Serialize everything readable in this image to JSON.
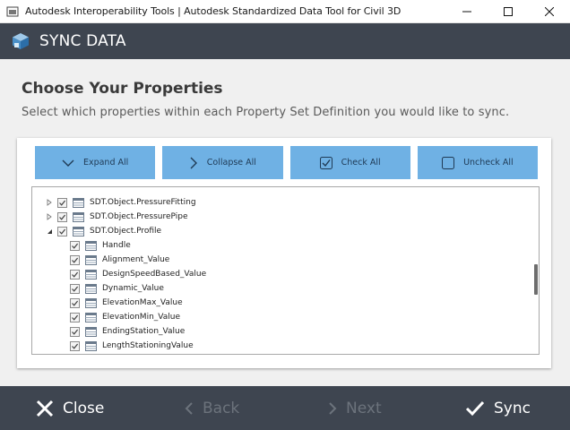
{
  "window": {
    "title": "Autodesk Interoperability Tools | Autodesk Standardized Data Tool for Civil 3D",
    "controls": [
      "minimize-icon",
      "maximize-icon",
      "close-icon"
    ]
  },
  "header": {
    "title": "SYNC DATA"
  },
  "main": {
    "heading": "Choose Your Properties",
    "subheading": "Select which properties within each Property Set Definition you would like to sync."
  },
  "toolbar": {
    "expand_label": "Expand All",
    "collapse_label": "Collapse All",
    "check_label": "Check All",
    "uncheck_label": "Uncheck All"
  },
  "tree": {
    "items": [
      {
        "label": "SDT.Object.PressureFitting",
        "checked": true,
        "expander": "collapsed"
      },
      {
        "label": "SDT.Object.PressurePipe",
        "checked": true,
        "expander": "collapsed"
      },
      {
        "label": "SDT.Object.Profile",
        "checked": true,
        "expander": "expanded"
      },
      {
        "label": "Handle",
        "checked": true
      },
      {
        "label": "Alignment_Value",
        "checked": true
      },
      {
        "label": "DesignSpeedBased_Value",
        "checked": true
      },
      {
        "label": "Dynamic_Value",
        "checked": true
      },
      {
        "label": "ElevationMax_Value",
        "checked": true
      },
      {
        "label": "ElevationMin_Value",
        "checked": true
      },
      {
        "label": "EndingStation_Value",
        "checked": true
      },
      {
        "label": "LengthStationingValue",
        "checked": true,
        "partial": true
      }
    ]
  },
  "footer": {
    "close_label": "Close",
    "back_label": "Back",
    "next_label": "Next",
    "sync_label": "Sync"
  },
  "colors": {
    "header_bg": "#3e4550",
    "toolbar_button": "#6fb1e4",
    "disabled_text": "#6c737c"
  }
}
